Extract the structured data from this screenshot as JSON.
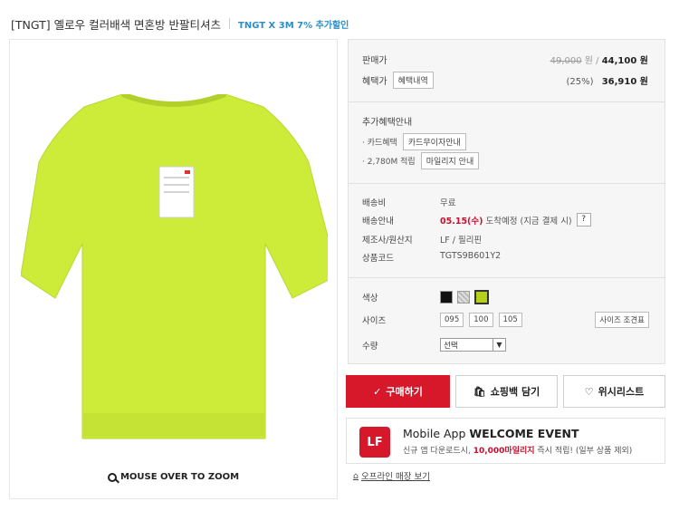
{
  "header": {
    "title": "[TNGT] 옐로우 컬러배색 면혼방 반팔티셔츠",
    "promo": "TNGT X 3M 7% 추가할인"
  },
  "image_panel": {
    "zoom_label": "MOUSE OVER TO ZOOM",
    "product_color": "#cdec3a"
  },
  "price": {
    "sale_label": "판매가",
    "original": "49,000",
    "unit": "원",
    "sale_price": "44,100 원",
    "benefit_label": "혜택가",
    "benefit_btn": "혜택내역",
    "discount": "(25%)",
    "benefit_price": "36,910 원"
  },
  "extra": {
    "title": "추가혜택안내",
    "card_label": "· 카드혜택",
    "card_btn": "카드무이자안내",
    "mileage_label": "· 2,780M 적립",
    "mileage_btn": "마일리지 안내"
  },
  "shipping": {
    "fee_label": "배송비",
    "fee_value": "무료",
    "info_label": "배송안내",
    "info_date": "05.15(수)",
    "info_rest": " 도착예정 (지금 결제 시)",
    "info_btn": "?",
    "maker_label": "제조사/원산지",
    "maker_value": "LF / 필리핀",
    "code_label": "상품코드",
    "code_value": "TGTS9B601Y2"
  },
  "options": {
    "color_label": "색상",
    "size_label": "사이즈",
    "sizes": [
      "095",
      "100",
      "105"
    ],
    "size_chart_btn": "사이즈 조견표",
    "qty_label": "수량",
    "qty_value": "선택",
    "colors": [
      "#111111",
      "#c8c8c8",
      "#b5cf1c"
    ]
  },
  "actions": {
    "buy": "구매하기",
    "cart": "쇼핑백 담기",
    "wish": "위시리스트"
  },
  "banner": {
    "logo": "LF",
    "title_prefix": "Mobile App ",
    "title_bold": "WELCOME EVENT",
    "desc_prefix": "신규 앱 다운로드시, ",
    "desc_highlight": "10,000마일리지",
    "desc_suffix": " 즉시 적립! (일부 상품 제외)"
  },
  "offline_link": "오프라인 매장 보기"
}
